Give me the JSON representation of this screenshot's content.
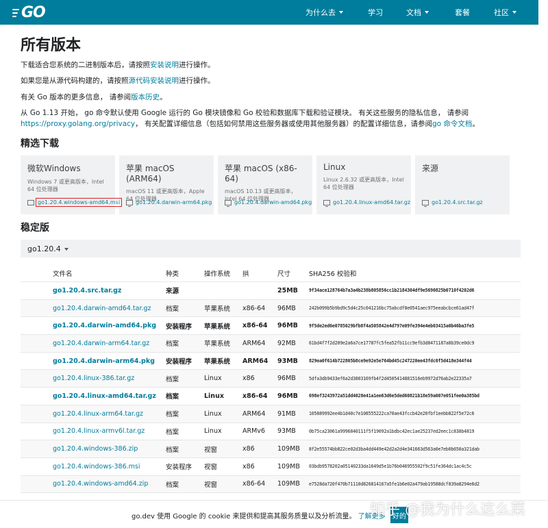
{
  "header": {
    "logo": "GO",
    "nav": [
      {
        "label": "为什么去",
        "dropdown": true
      },
      {
        "label": "学习",
        "dropdown": false
      },
      {
        "label": "文档",
        "dropdown": true
      },
      {
        "label": "套餐",
        "dropdown": false
      },
      {
        "label": "社区",
        "dropdown": true
      }
    ]
  },
  "page_title": "所有版本",
  "intro": {
    "p1_pre": "下载适合您系统的二进制版本后，请按照",
    "p1_link": "安装说明",
    "p1_post": "进行操作。",
    "p2_pre": "如果您是从源代码构建的，请按照",
    "p2_link": "源代码安装说明",
    "p2_post": "进行操作。",
    "p3_pre": "有关 Go 版本的更多信息， 请参阅",
    "p3_link": "版本历史",
    "p3_post": "。",
    "p4_line1": "从 Go 1.13 开始， go 命令默认使用 Google 运行的 Go 模块镜像和 Go 校验和数据库下载和验证模块。 有关这些服务的隐私信息， 请参阅",
    "p4_link1": "https://proxy.golang.org/privacy",
    "p4_mid": "， 有关配置详细信息（包括如何禁用这些服务器或使用其他服务器）的配置详细信息，请参阅",
    "p4_link2": "go 命令文档",
    "p4_post": "。"
  },
  "featured": {
    "heading": "精选下载",
    "cards": [
      {
        "title": "微软Windows",
        "desc": "Windows 7 或更高版本，Intel 64 位处理器",
        "file": "go1.20.4.windows-amd64.msi"
      },
      {
        "title": "苹果 macOS (ARM64)",
        "desc": "macOS 11 或更高版本，Apple 64 位处理器",
        "file": "go1.20.4.darwin-arm64.pkg"
      },
      {
        "title": "苹果 macOS (x86-64)",
        "desc": "macOS 10.13 或更高版本，Intel 64 位处理器",
        "file": "go1.20.4.darwin-amd64.pkg"
      },
      {
        "title": "Linux",
        "desc": "Linux 2.6.32 或更高版本，Intel 64 位处理器",
        "file": "go1.20.4.linux-amd64.tar.gz"
      },
      {
        "title": "来源",
        "desc": "",
        "file": "go1.20.4.src.tar.gz"
      }
    ]
  },
  "stable": {
    "heading": "稳定版",
    "version": "go1.20.4"
  },
  "table": {
    "headers": [
      "文件名",
      "种类",
      "操作系统",
      "拱",
      "尺寸",
      "SHA256 校验和"
    ],
    "rows": [
      {
        "file": "go1.20.4.src.tar.gz",
        "kind": "来源",
        "os": "",
        "arch": "",
        "size": "25MB",
        "sha": "9f34ace128764b7a3a4b238b805856cc1b2184304df9e5690825b0710f4202d6",
        "bold": true
      },
      {
        "file": "go1.20.4.darwin-amd64.tar.gz",
        "kind": "档案",
        "os": "苹果系统",
        "arch": "x86-64",
        "size": "96MB",
        "sha": "242b099b5b9bd9c5d4c25c041216bc75abcdf8e0541aec975eeabcbce61ad47f",
        "bold": false
      },
      {
        "file": "go1.20.4.darwin-amd64.pkg",
        "kind": "安装程序",
        "os": "苹果系统",
        "arch": "x86-64",
        "size": "96MB",
        "sha": "9f5de2ed6e0785029bfb8f4a505842e4d797e09fe394e4eb03415a0b46ba3fe5",
        "bold": true
      },
      {
        "file": "go1.20.4.darwin-arm64.tar.gz",
        "kind": "档案",
        "os": "苹果系统",
        "arch": "ARM64",
        "size": "92MB",
        "sha": "61bd4f7f2d209e2a6a7ce17787fc5fea52fb11cc9efb3d8471187a8b39ce0dc9",
        "bold": false
      },
      {
        "file": "go1.20.4.darwin-arm64.pkg",
        "kind": "安装程序",
        "os": "苹果系统",
        "arch": "ARM64",
        "size": "93MB",
        "sha": "829ea0f614b722805b8ce9e92e5e764bd45c247220ee43fdc0f5d418e344f44",
        "bold": true
      },
      {
        "file": "go1.20.4.linux-386.tar.gz",
        "kind": "档案",
        "os": "Linux",
        "arch": "x86",
        "size": "96MB",
        "sha": "5dfa3db9433ef6a2d3803169fb4f2d4505414881516eb9972d76ab2e22335a7",
        "bold": false
      },
      {
        "file": "go1.20.4.linux-amd64.tar.gz",
        "kind": "档案",
        "os": "Linux",
        "arch": "x86-64",
        "size": "96MB",
        "sha": "698ef3243972a51dd4028e41a1ee63d6e5ded60821b18e59a007e051fee0a385bd",
        "bold": true
      },
      {
        "file": "go1.20.4.linux-arm64.tar.gz",
        "kind": "档案",
        "os": "Linux",
        "arch": "ARM64",
        "size": "91MB",
        "sha": "105889992ee4b1d40c7e108555222ca70ae43fccb42e20fbf1eebb822f5e72c6",
        "bold": false
      },
      {
        "file": "go1.20.4.linux-armv6l.tar.gz",
        "kind": "档案",
        "os": "Linux",
        "arch": "ARMv6",
        "size": "93MB",
        "sha": "0b75ca23061a9996840111f5f19092a1bdbc42ec1ae25237ed2eec1c838b4819",
        "bold": false
      },
      {
        "file": "go1.20.4.windows-386.zip",
        "kind": "档案",
        "os": "视窗",
        "arch": "x86",
        "size": "109MB",
        "sha": "8f2e55574bb822ce02d3ba4dd449e42d2a2d4e341663d563a0e7eb0b650a321dab",
        "bold": false
      },
      {
        "file": "go1.20.4.windows-386.msi",
        "kind": "安装程序",
        "os": "视窗",
        "arch": "x86",
        "size": "109MB",
        "sha": "03bdb9578202a05140233da1649d5e1b76b046955502f9c51fe364dc1ac4c5c",
        "bold": false
      },
      {
        "file": "go1.20.4.windows-amd64.zip",
        "kind": "档案",
        "os": "视窗",
        "arch": "x86-64",
        "size": "109MB",
        "sha": "e7528da720f470b71110d826814167a5fe1b6e02a479ab19588dcf839a8294e6d2",
        "bold": false
      }
    ]
  },
  "cookie": {
    "text": "go.dev 使用 Google 的 cookie 来提供和提高其服务质量以及分析流量。",
    "link": "了解更多",
    "ok": "好的"
  },
  "watermark": "知乎 @我为什么这么菜",
  "colors": {
    "brand": "#007d9c",
    "highlight_box": "#e02020"
  }
}
